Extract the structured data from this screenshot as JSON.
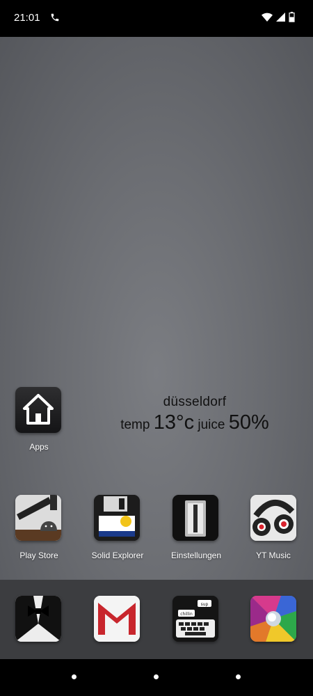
{
  "status_bar": {
    "time": "21:01",
    "icons": [
      "phone-call-icon",
      "wifi-icon",
      "signal-icon",
      "battery-icon"
    ]
  },
  "widget": {
    "city": "düsseldorf",
    "temp_label": "temp",
    "temp_value": "13°c",
    "juice_label": "juice",
    "juice_value": "50%"
  },
  "home": {
    "apps_label": "Apps",
    "row": [
      {
        "label": "Play Store",
        "icon": "play-store-icon"
      },
      {
        "label": "Solid Explorer",
        "icon": "floppy-disk-icon"
      },
      {
        "label": "Einstellungen",
        "icon": "settings-switch-icon"
      },
      {
        "label": "YT Music",
        "icon": "headphones-icon"
      }
    ]
  },
  "dock": {
    "icons": [
      "tuxedo-icon",
      "gmail-icon",
      "typewriter-chat-icon",
      "photos-pinwheel-icon"
    ],
    "chat_bubble_1": "chillin",
    "chat_bubble_2": "sup"
  },
  "colors": {
    "wallpaper": "#6b6d72",
    "dock": "#3c3d40",
    "status_bar": "#000000"
  }
}
